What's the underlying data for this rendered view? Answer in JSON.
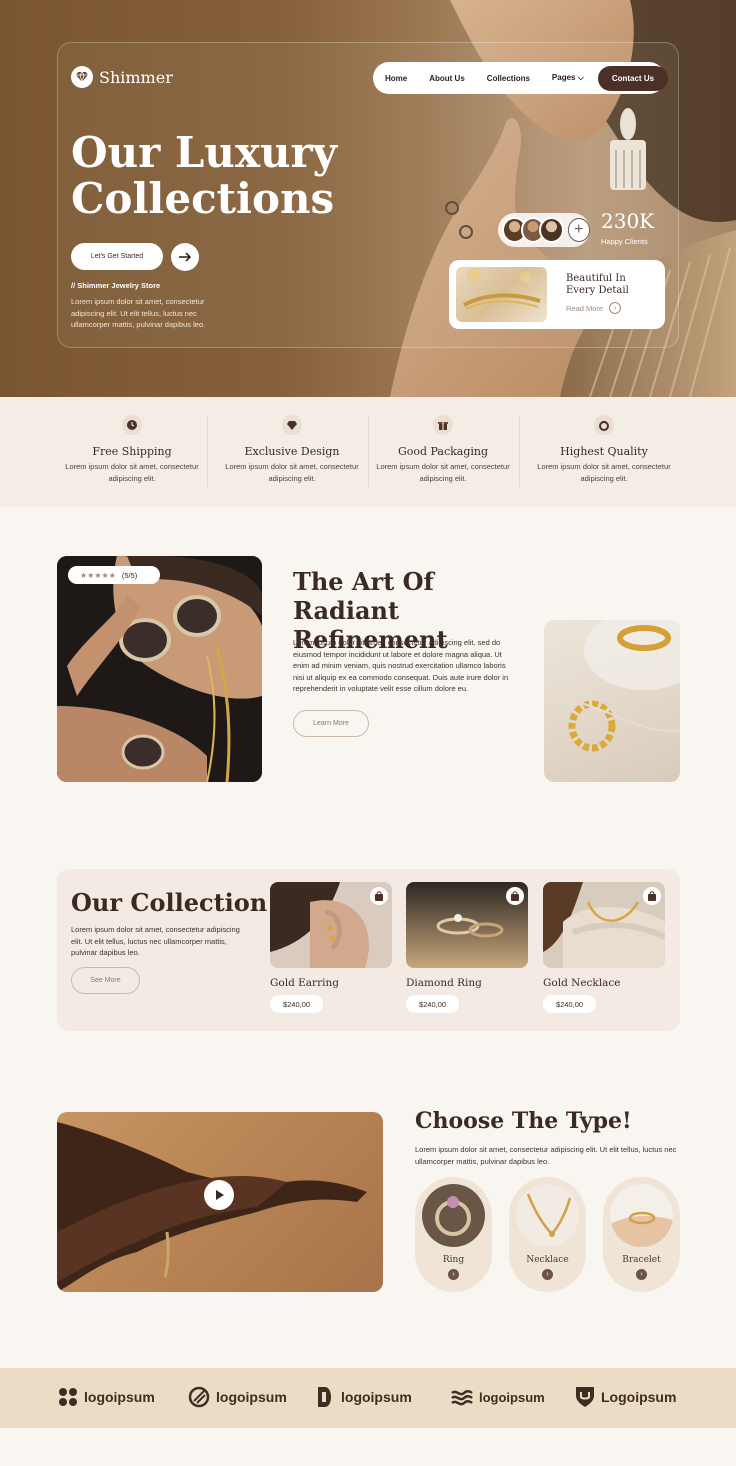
{
  "brand": {
    "name": "Shimmer"
  },
  "nav": {
    "items": [
      "Home",
      "About Us",
      "Collections",
      "Pages"
    ],
    "contact": "Contact Us"
  },
  "hero": {
    "title": "Our Luxury Collections",
    "cta": "Let's Get Started",
    "store_tag": "// Shimmer Jewelry Store",
    "store_desc": "Lorem ipsum dolor sit amet, consectetur adipiscing elit. Ut elit tellus, luctus nec ullamcorper mattis, pulvinar dapibus leo.",
    "clients_count": "230K",
    "clients_label": "Happy Clients",
    "detail_title": "Beautiful In Every Detail",
    "detail_more": "Read More"
  },
  "features": [
    {
      "title": "Free Shipping",
      "desc": "Lorem ipsum dolor sit amet, consectetur adipiscing elit."
    },
    {
      "title": "Exclusive Design",
      "desc": "Lorem ipsum dolor sit amet, consectetur adipiscing elit."
    },
    {
      "title": "Good Packaging",
      "desc": "Lorem ipsum dolor sit amet, consectetur adipiscing elit."
    },
    {
      "title": "Highest Quality",
      "desc": "Lorem ipsum dolor sit amet, consectetur adipiscing elit."
    }
  ],
  "radiant": {
    "rating": "(5/5)",
    "title": "The Art Of Radiant Refinement",
    "text": "Lorem ipsum dolor sit amet, consectetur adipiscing elit, sed do eiusmod tempor incididunt ut labore et dolore magna aliqua. Ut enim ad minim veniam, quis nostrud exercitation ullamco laboris nisi ut aliquip ex ea commodo consequat. Duis aute irure dolor in reprehenderit in voluptate velit esse cillum dolore eu.",
    "cta": "Learn More"
  },
  "collection": {
    "title": "Our Collection",
    "text": "Lorem ipsum dolor sit amet, consectetur adipiscing elit. Ut elit tellus, luctus nec ullamcorper mattis, pulvinar dapibus leo.",
    "cta": "See More",
    "products": [
      {
        "name": "Gold Earring",
        "price": "$240,00"
      },
      {
        "name": "Diamond Ring",
        "price": "$240,00"
      },
      {
        "name": "Gold Necklace",
        "price": "$240,00"
      }
    ]
  },
  "types": {
    "title": "Choose The Type!",
    "text": "Lorem ipsum dolor sit amet, consectetur adipiscing elit. Ut elit tellus, luctus nec ullamcorper mattis, pulvinar dapibus leo.",
    "items": [
      "Ring",
      "Necklace",
      "Bracelet"
    ]
  },
  "partners": [
    "logoipsum",
    "logoipsum",
    "logoipsum",
    "logoipsum",
    "Logoipsum"
  ],
  "colors": {
    "brand_dark": "#4a3026",
    "hero_brown": "#86603a",
    "cream": "#f9f6f1",
    "beige": "#ecdcc6"
  }
}
